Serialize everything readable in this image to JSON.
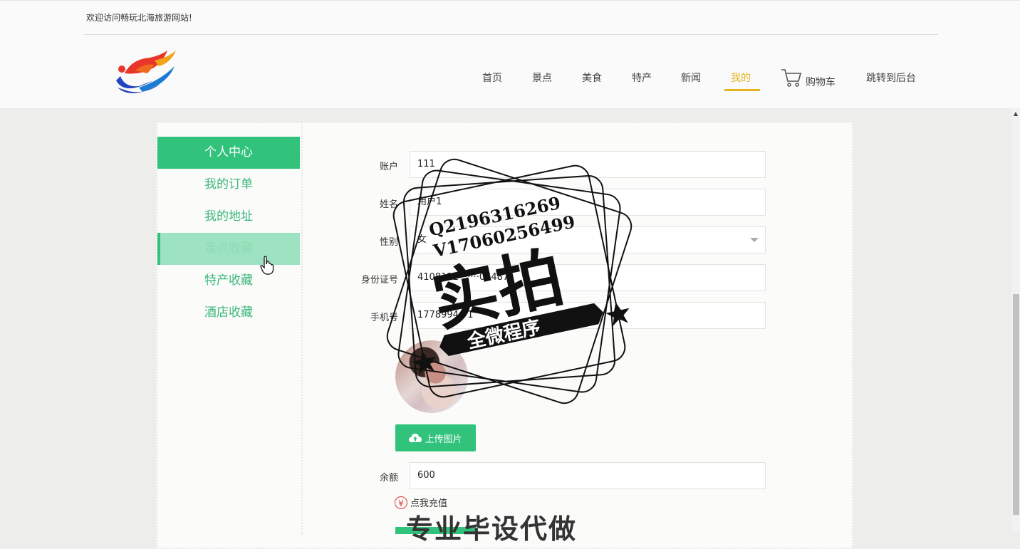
{
  "header": {
    "welcome": "欢迎访问畅玩北海旅游网站!",
    "logo_icon": "site-logo",
    "nav": [
      {
        "label": "首页",
        "active": false
      },
      {
        "label": "景点",
        "active": false
      },
      {
        "label": "美食",
        "active": false
      },
      {
        "label": "特产",
        "active": false
      },
      {
        "label": "新闻",
        "active": false
      },
      {
        "label": "我的",
        "active": true
      },
      {
        "label": "购物车",
        "active": false,
        "icon": "cart-icon"
      },
      {
        "label": "跳转到后台",
        "active": false
      }
    ],
    "active_color": "#e5b31c"
  },
  "sidebar": {
    "title": "个人中心",
    "items": [
      {
        "label": "我的订单"
      },
      {
        "label": "我的地址"
      },
      {
        "label": "景点收藏",
        "hovered": true
      },
      {
        "label": "特产收藏"
      },
      {
        "label": "酒店收藏"
      }
    ],
    "accent_color": "#31c27c"
  },
  "form": {
    "account_label": "账户",
    "account_value": "111",
    "name_label": "姓名",
    "name_value": "用户1",
    "gender_label": "性别",
    "gender_value": "女",
    "idcard_label": "身份证号",
    "idcard_value": "4108122·······064871",
    "phone_label": "手机号",
    "phone_value": "1778994···1",
    "upload_label": "上传图片",
    "upload_icon": "cloud-upload-icon",
    "balance_label": "余额",
    "balance_value": "600",
    "recharge_label": "点我充值",
    "recharge_icon": "yen-icon"
  },
  "watermark": {
    "line1": "Q2196316269",
    "line2": "V17060256499",
    "main": "实拍",
    "ribbon": "全微程序",
    "bottom": "专业毕设代做"
  }
}
